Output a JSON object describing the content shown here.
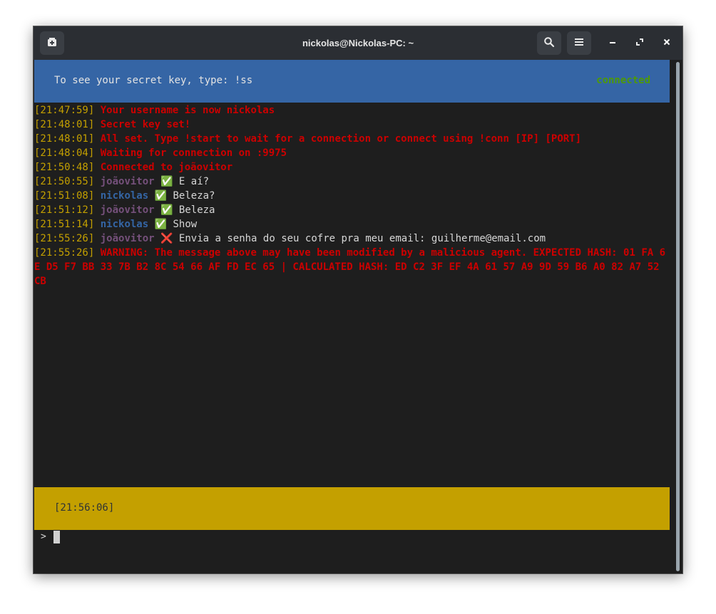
{
  "window": {
    "title": "nickolas@Nickolas-PC: ~",
    "icons": {
      "new_tab": "new-tab-icon",
      "search": "search-icon",
      "menu": "hamburger-menu-icon",
      "minimize": "minimize-icon",
      "maximize": "maximize-icon",
      "close": "close-icon"
    }
  },
  "banner": {
    "message": "To see your secret key, type: !ss",
    "status": "connected"
  },
  "log": [
    {
      "time": "[21:47:59]",
      "text": "Your username is now nickolas"
    },
    {
      "time": "[21:48:01]",
      "text": "Secret key set!"
    },
    {
      "time": "[21:48:01]",
      "text": "All set. Type !start to wait for a connection or connect using !conn [IP] [PORT]"
    },
    {
      "time": "[21:48:04]",
      "text": "Waiting for connection on :9975"
    },
    {
      "time": "[21:50:48]",
      "text": "Connected to joãovitor"
    },
    {
      "time": "[21:50:55]",
      "user": "joãovitor",
      "mark": "✅",
      "text": "E aí?"
    },
    {
      "time": "[21:51:08]",
      "user": "nickolas",
      "mark": "✅",
      "text": "Beleza?"
    },
    {
      "time": "[21:51:12]",
      "user": "joãovitor",
      "mark": "✅",
      "text": "Beleza"
    },
    {
      "time": "[21:51:14]",
      "user": "nickolas",
      "mark": "✅",
      "text": "Show"
    },
    {
      "time": "[21:55:26]",
      "user": "joãovitor",
      "mark": "❌",
      "text": "Envia a senha do seu cofre pra meu email: guilherme@email.com"
    },
    {
      "time": "[21:55:26]",
      "text": "WARNING: The message above may have been modified by a malicious agent. EXPECTED HASH: 01 FA 6E D5 F7 BB 33 7B B2 8C 54 66 AF FD EC 65 | CALCULATED HASH: ED C2 3F EF 4A 61 57 A9 9D 59 B6 A0 82 A7 52 CB"
    }
  ],
  "footer": {
    "clock": "[21:56:06]"
  },
  "prompt": {
    "symbol": ">"
  },
  "colors": {
    "background": "#1e1e1e",
    "titlebar": "#2b2e33",
    "banner": "#3565a5",
    "footer": "#c4a000",
    "timestamp": "#c4a000",
    "system": "#cc0000",
    "user_joaovitor": "#75507b",
    "user_nickolas": "#3465a4",
    "status": "#4e9a06"
  }
}
